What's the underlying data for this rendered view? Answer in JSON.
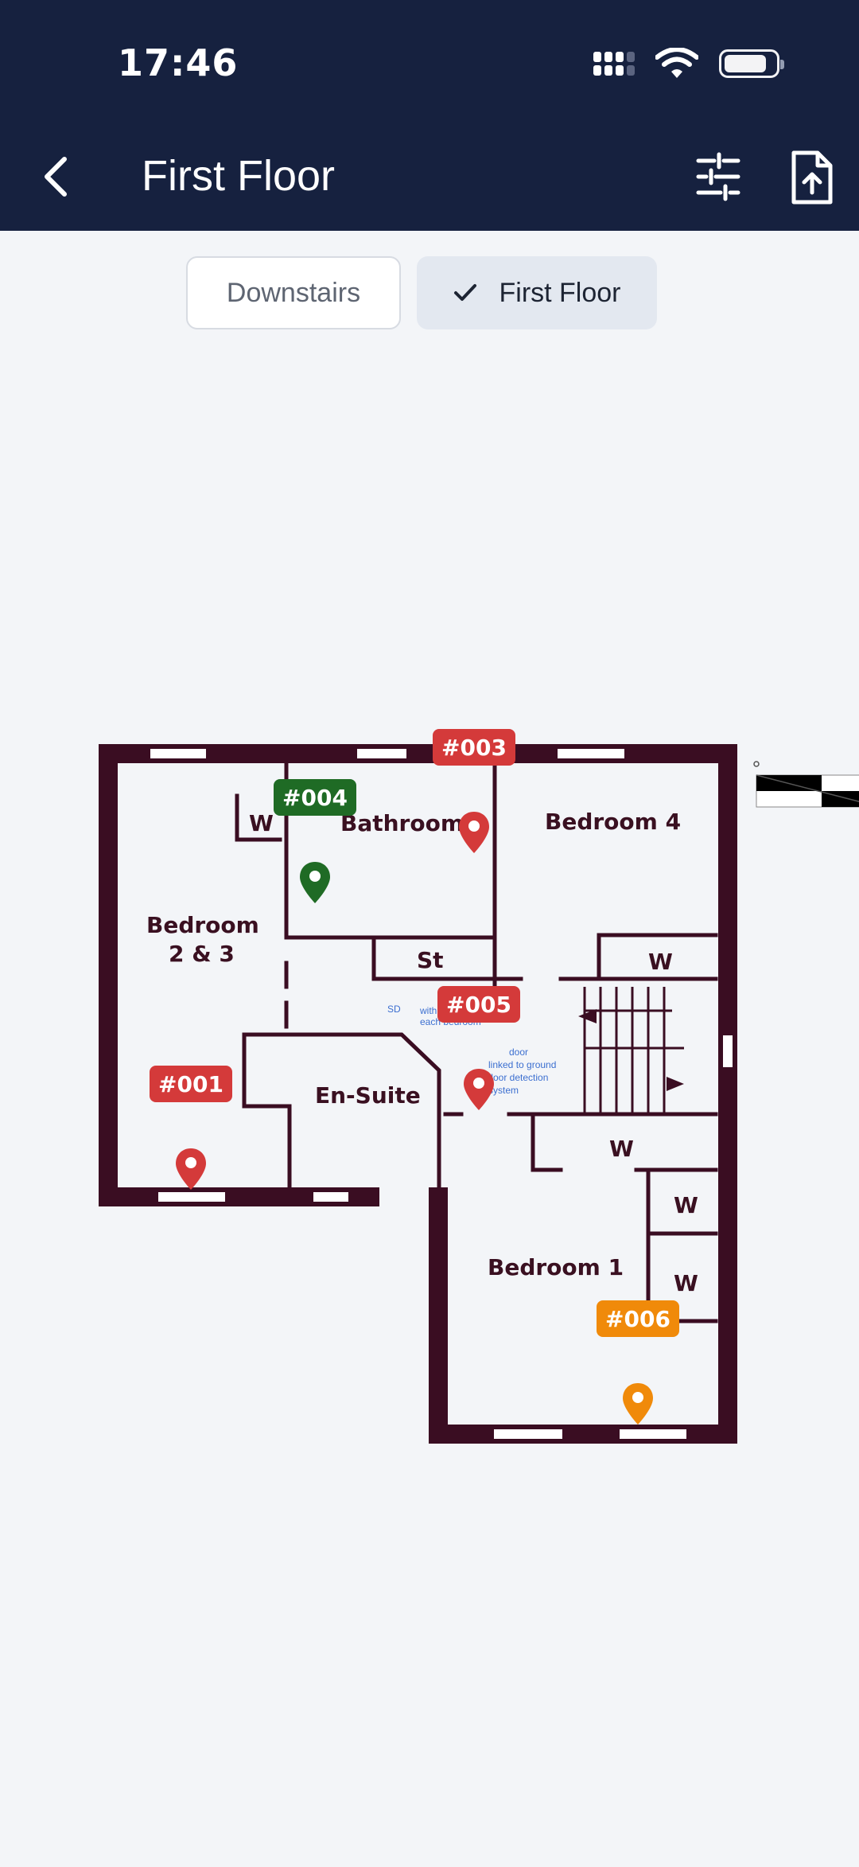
{
  "status_bar": {
    "time": "17:46"
  },
  "header": {
    "title": "First Floor"
  },
  "floor_tabs": [
    {
      "label": "Downstairs",
      "selected": false
    },
    {
      "label": "First Floor",
      "selected": true
    }
  ],
  "floor_plan": {
    "rooms": [
      "Bathroom",
      "Bedroom 4",
      "Bedroom\n2 & 3",
      "St",
      "En-Suite",
      "Bedroom 1",
      "W"
    ],
    "notes": [
      "SD",
      "within 3m of each bedroom",
      "door linked to ground floor detection system"
    ]
  },
  "pins": [
    {
      "label": "#001",
      "color": "#d43a3a"
    },
    {
      "label": "#003",
      "color": "#d43a3a"
    },
    {
      "label": "#004",
      "color": "#1f6b25"
    },
    {
      "label": "#005",
      "color": "#d43a3a"
    },
    {
      "label": "#006",
      "color": "#f08a0a"
    }
  ],
  "colors": {
    "header_bg": "#16213f",
    "wall": "#3a0d22",
    "selected_tab": "#e3e8f0"
  }
}
